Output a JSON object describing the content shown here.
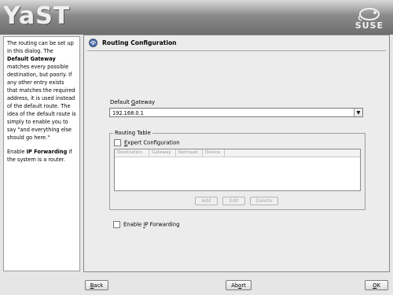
{
  "banner": {
    "logo": "YaST",
    "brand": "SUSE"
  },
  "help": {
    "p1_a": "The routing can be set up in this dialog. The ",
    "p1_b": "Default Gateway",
    "p1_c": " matches every possible destination, but poorly. If any other entry exists that matches the required address, it is used instead of the default route. The idea of the default route is simply to enable you to say \"and everything else should go here.\"",
    "p2_a": "Enable ",
    "p2_b": "IP Forwarding",
    "p2_c": " if the system is a router."
  },
  "dialog": {
    "title": "Routing Configuration",
    "gateway_label_pre": "Default ",
    "gateway_label_u": "G",
    "gateway_label_post": "ateway",
    "gateway_value": "192.168.0.1",
    "routing_table": {
      "legend": "Routing Table",
      "expert_u": "E",
      "expert_rest": "xpert Configuration",
      "expert_checked": false,
      "columns": [
        "Destination",
        "Gateway",
        "Netmask",
        "Device"
      ],
      "add": "Add",
      "edit": "Edit",
      "delete": "Delete"
    },
    "ipf_pre": "Enable ",
    "ipf_u": "I",
    "ipf_post": "P Forwarding",
    "ipf_checked": false
  },
  "footer": {
    "back_u": "B",
    "back_rest": "ack",
    "abort_pre": "Ab",
    "abort_u": "o",
    "abort_post": "rt",
    "ok_u": "O",
    "ok_rest": "K"
  }
}
